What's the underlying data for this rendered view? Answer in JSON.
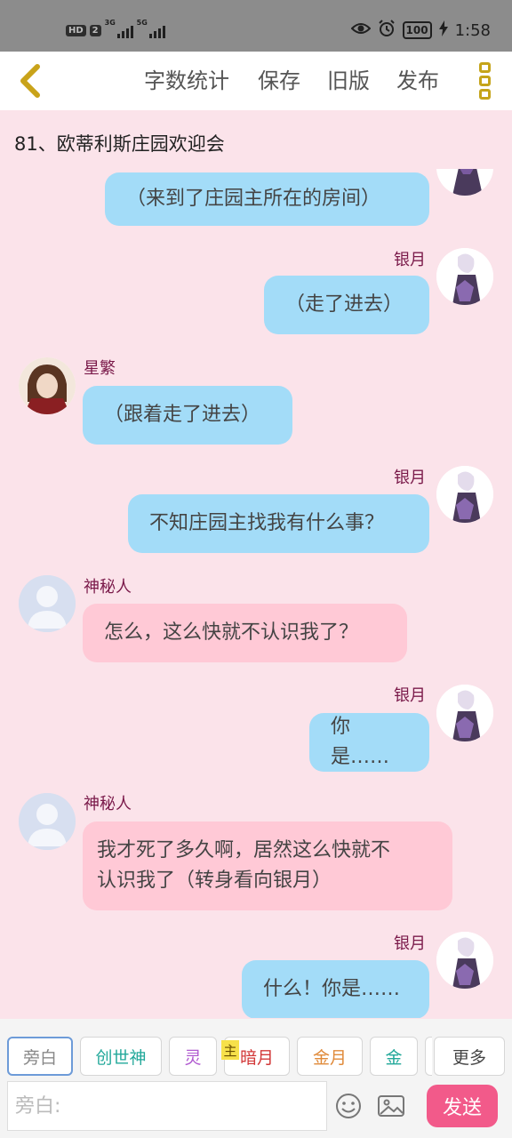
{
  "status_bar": {
    "hd_label": "HD",
    "sim_label": "2",
    "net1": "3G",
    "net2": "5G",
    "battery": "100",
    "time": "1:58"
  },
  "toolbar": {
    "back_icon": "chevron-left-icon",
    "word_count": "字数统计",
    "save": "保存",
    "old_version": "旧版",
    "publish": "发布",
    "menu_icon": "vertical-dots-icon"
  },
  "chapter_title": "81、欧蒂利斯庄园欢迎会",
  "messages": [
    {
      "speaker": "",
      "text": "（来到了庄园主所在的房间）",
      "side": "right",
      "color": "blue"
    },
    {
      "speaker": "银月",
      "text": "（走了进去）",
      "side": "right",
      "color": "blue"
    },
    {
      "speaker": "星繁",
      "text": "（跟着走了进去）",
      "side": "left",
      "color": "blue"
    },
    {
      "speaker": "银月",
      "text": "不知庄园主找我有什么事？",
      "side": "right",
      "color": "blue"
    },
    {
      "speaker": "神秘人",
      "text": "怎么，这么快就不认识我了？",
      "side": "left",
      "color": "pink"
    },
    {
      "speaker": "银月",
      "text": "你是……",
      "side": "right",
      "color": "blue"
    },
    {
      "speaker": "神秘人",
      "text_lines": [
        "我才死了多久啊，居然这么快就不",
        "认识我了（转身看向银月）"
      ],
      "side": "left",
      "color": "pink"
    },
    {
      "speaker": "银月",
      "text": "什么！你是……",
      "side": "right",
      "color": "blue"
    }
  ],
  "roles": [
    {
      "label": "旁白",
      "color": "#888888",
      "selected": true
    },
    {
      "label": "创世神",
      "color": "#22a89a"
    },
    {
      "label": "灵",
      "color": "#b05ad0"
    },
    {
      "label": "暗月",
      "color": "#d23838",
      "badge": "主"
    },
    {
      "label": "金月",
      "color": "#e08a3a"
    },
    {
      "label": "金",
      "color": "#22a89a"
    },
    {
      "label": "更多",
      "color": "#444444"
    }
  ],
  "input": {
    "placeholder": "旁白:"
  },
  "send": "发送",
  "icons": {
    "emoji": "emoji-icon",
    "image": "image-icon"
  }
}
